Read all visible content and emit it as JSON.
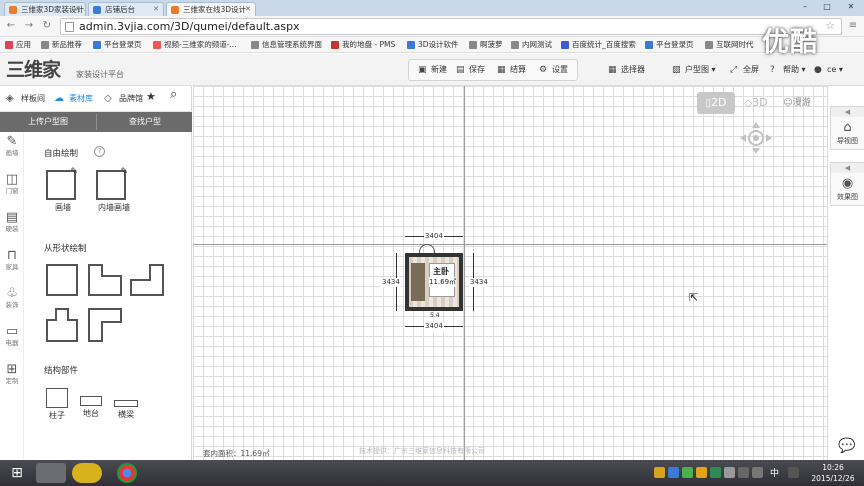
{
  "browser": {
    "tabs": [
      {
        "label": "三维家3D家装设计导购网",
        "fav_color": "#e87d2c"
      },
      {
        "label": "店铺后台",
        "fav_color": "#3a7bd5"
      },
      {
        "label": "三维家在线3D设计",
        "fav_color": "#e87d2c",
        "active": true
      }
    ],
    "window_controls": [
      "–",
      "□",
      "✕"
    ],
    "url": "admin.3vjia.com/3D/qumei/default.aspx",
    "bookmarks": [
      {
        "label": "应用",
        "color": "#d45"
      },
      {
        "label": "新品推荐",
        "color": "#888"
      },
      {
        "label": "平台登录页",
        "color": "#3a7bd5"
      },
      {
        "label": "视频-三维家的频道-...",
        "color": "#e55"
      },
      {
        "label": "信息管理系统界面",
        "color": "#888"
      },
      {
        "label": "我的地盘 - PMS",
        "color": "#c33"
      },
      {
        "label": "3D设计软件",
        "color": "#3a7bd5"
      },
      {
        "label": "啊菠萝",
        "color": "#888"
      },
      {
        "label": "内网测试",
        "color": "#888"
      },
      {
        "label": "百度统计_百度搜索",
        "color": "#3a5bd5"
      },
      {
        "label": "平台登录页",
        "color": "#3a7bd5"
      },
      {
        "label": "互联网时代",
        "color": "#888"
      }
    ]
  },
  "app": {
    "logo": "三维家",
    "logo_sub": "家装设计平台",
    "header_buttons": [
      {
        "label": "新建",
        "icon": "new-file-icon",
        "glyph": "▣"
      },
      {
        "label": "保存",
        "icon": "save-icon",
        "glyph": "▤"
      },
      {
        "label": "结算",
        "icon": "checkout-icon",
        "glyph": "▦"
      },
      {
        "label": "设置",
        "icon": "gear-icon",
        "glyph": "⚙"
      }
    ],
    "header_right": [
      {
        "label": "选择器",
        "icon": "selector-icon",
        "glyph": "▦"
      },
      {
        "label": "户型图",
        "icon": "floorplan-icon",
        "glyph": "▧"
      },
      {
        "label": "全屏",
        "icon": "fullscreen-icon",
        "glyph": "⤢"
      },
      {
        "label": "帮助",
        "icon": "help-icon",
        "glyph": "?"
      },
      {
        "label": "ce",
        "icon": "user-icon",
        "glyph": "●"
      }
    ]
  },
  "left_panel": {
    "tabs": [
      {
        "label": "样板间",
        "icon": "sample-room-icon",
        "glyph": "◈"
      },
      {
        "label": "素材库",
        "icon": "cloud-icon",
        "glyph": "☁",
        "active": true
      },
      {
        "label": "品牌馆",
        "icon": "tag-icon",
        "glyph": "◇"
      }
    ],
    "favorite_glyph": "★",
    "search_glyph": "⌕",
    "subbuttons": [
      "上传户型图",
      "查找户型"
    ],
    "vnav": [
      {
        "label": "画墙",
        "glyph": "✎"
      },
      {
        "label": "门窗",
        "glyph": "◫"
      },
      {
        "label": "硬装",
        "glyph": "▤"
      },
      {
        "label": "家具",
        "glyph": "⊓"
      },
      {
        "label": "装饰",
        "glyph": "♧"
      },
      {
        "label": "电器",
        "glyph": "▭"
      },
      {
        "label": "定制",
        "glyph": "⊞"
      }
    ],
    "free_draw_title": "自由绘制",
    "help_glyph": "?",
    "free_tools": [
      "画墙",
      "内墙画墙"
    ],
    "shape_draw_title": "从形状绘制",
    "structure_title": "结构部件",
    "structure_tools": [
      "柱子",
      "地台",
      "横梁"
    ]
  },
  "canvas": {
    "view_modes": [
      "2D",
      "3D",
      "漫游"
    ],
    "room_name": "主卧",
    "room_area": "11.69㎡",
    "dim_width": "3404",
    "dim_height": "3434",
    "bottom_label": "5.4",
    "status_area": "套内面积：11.69㎡",
    "footer": "技术提供：广东三维家信息科技有限公司"
  },
  "right_tools": [
    {
      "label": "导视图",
      "icon": "home-icon",
      "glyph": "⌂"
    },
    {
      "label": "效果图",
      "icon": "camera-icon",
      "glyph": "◉"
    }
  ],
  "taskbar": {
    "time": "10:26",
    "date": "2015/12/26",
    "ime": "中",
    "start_glyph": "⊞"
  },
  "watermark": "优酷"
}
